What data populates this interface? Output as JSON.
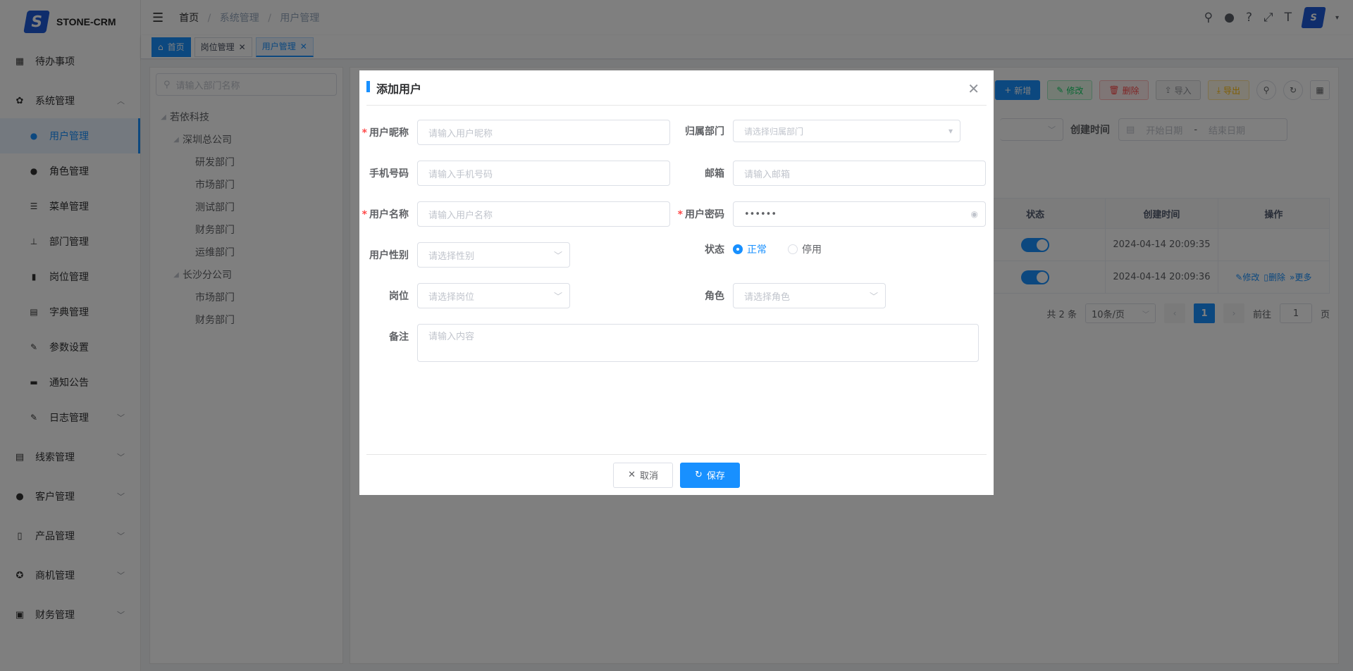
{
  "app": {
    "logo_letter": "S",
    "name": "STONE-CRM"
  },
  "sidebar": {
    "items": [
      {
        "label": "待办事项",
        "icon": "grid-icon"
      },
      {
        "label": "系统管理",
        "icon": "gear-icon",
        "expanded": true,
        "children": [
          {
            "label": "用户管理",
            "icon": "user-icon",
            "active": true
          },
          {
            "label": "角色管理",
            "icon": "peoples-icon"
          },
          {
            "label": "菜单管理",
            "icon": "tree-table-icon"
          },
          {
            "label": "部门管理",
            "icon": "tree-icon"
          },
          {
            "label": "岗位管理",
            "icon": "post-icon"
          },
          {
            "label": "字典管理",
            "icon": "dict-icon"
          },
          {
            "label": "参数设置",
            "icon": "edit-icon"
          },
          {
            "label": "通知公告",
            "icon": "message-icon"
          },
          {
            "label": "日志管理",
            "icon": "log-icon"
          }
        ]
      },
      {
        "label": "线索管理",
        "icon": "clue-icon"
      },
      {
        "label": "客户管理",
        "icon": "customer-icon"
      },
      {
        "label": "产品管理",
        "icon": "product-icon"
      },
      {
        "label": "商机管理",
        "icon": "opportunity-icon"
      },
      {
        "label": "财务管理",
        "icon": "finance-icon"
      }
    ]
  },
  "header": {
    "breadcrumb": [
      "首页",
      "系统管理",
      "用户管理"
    ]
  },
  "tags": {
    "home": "首页",
    "items": [
      "岗位管理",
      "用户管理"
    ]
  },
  "dept": {
    "search_placeholder": "请输入部门名称",
    "tree": [
      {
        "label": "若依科技",
        "level": 0
      },
      {
        "label": "深圳总公司",
        "level": 1
      },
      {
        "label": "研发部门",
        "level": 2
      },
      {
        "label": "市场部门",
        "level": 2
      },
      {
        "label": "测试部门",
        "level": 2
      },
      {
        "label": "财务部门",
        "level": 2
      },
      {
        "label": "运维部门",
        "level": 2
      },
      {
        "label": "长沙分公司",
        "level": 1
      },
      {
        "label": "市场部门",
        "level": 2
      },
      {
        "label": "财务部门",
        "level": 2
      }
    ]
  },
  "toolbar": {
    "add": "新增",
    "edit": "修改",
    "delete": "删除",
    "import": "导入",
    "export": "导出"
  },
  "filter": {
    "created_label": "创建时间",
    "start_placeholder": "开始日期",
    "range_sep": "-",
    "end_placeholder": "结束日期"
  },
  "table": {
    "headers": [
      "状态",
      "创建时间",
      "操作"
    ],
    "rows": [
      {
        "status": true,
        "created": "2024-04-14 20:09:35",
        "ops": []
      },
      {
        "status": true,
        "created": "2024-04-14 20:09:36",
        "ops": [
          "修改",
          "删除",
          "更多"
        ]
      }
    ]
  },
  "pager": {
    "total": "共 2 条",
    "page_size": "10条/页",
    "current": "1",
    "goto_label": "前往",
    "goto_value": "1",
    "page_suffix": "页"
  },
  "dialog": {
    "title": "添加用户",
    "fields": {
      "nickname": {
        "label": "用户昵称",
        "placeholder": "请输入用户昵称"
      },
      "dept": {
        "label": "归属部门",
        "placeholder": "请选择归属部门"
      },
      "phone": {
        "label": "手机号码",
        "placeholder": "请输入手机号码"
      },
      "email": {
        "label": "邮箱",
        "placeholder": "请输入邮箱"
      },
      "username": {
        "label": "用户名称",
        "placeholder": "请输入用户名称"
      },
      "password": {
        "label": "用户密码",
        "value": "••••••"
      },
      "gender": {
        "label": "用户性别",
        "placeholder": "请选择性别"
      },
      "status": {
        "label": "状态",
        "options": [
          "正常",
          "停用"
        ],
        "selected": "正常"
      },
      "post": {
        "label": "岗位",
        "placeholder": "请选择岗位"
      },
      "role": {
        "label": "角色",
        "placeholder": "请选择角色"
      },
      "remark": {
        "label": "备注",
        "placeholder": "请输入内容"
      }
    },
    "cancel": "取消",
    "save": "保存"
  },
  "colors": {
    "primary": "#1890ff",
    "brand": "#1e5bd8"
  }
}
